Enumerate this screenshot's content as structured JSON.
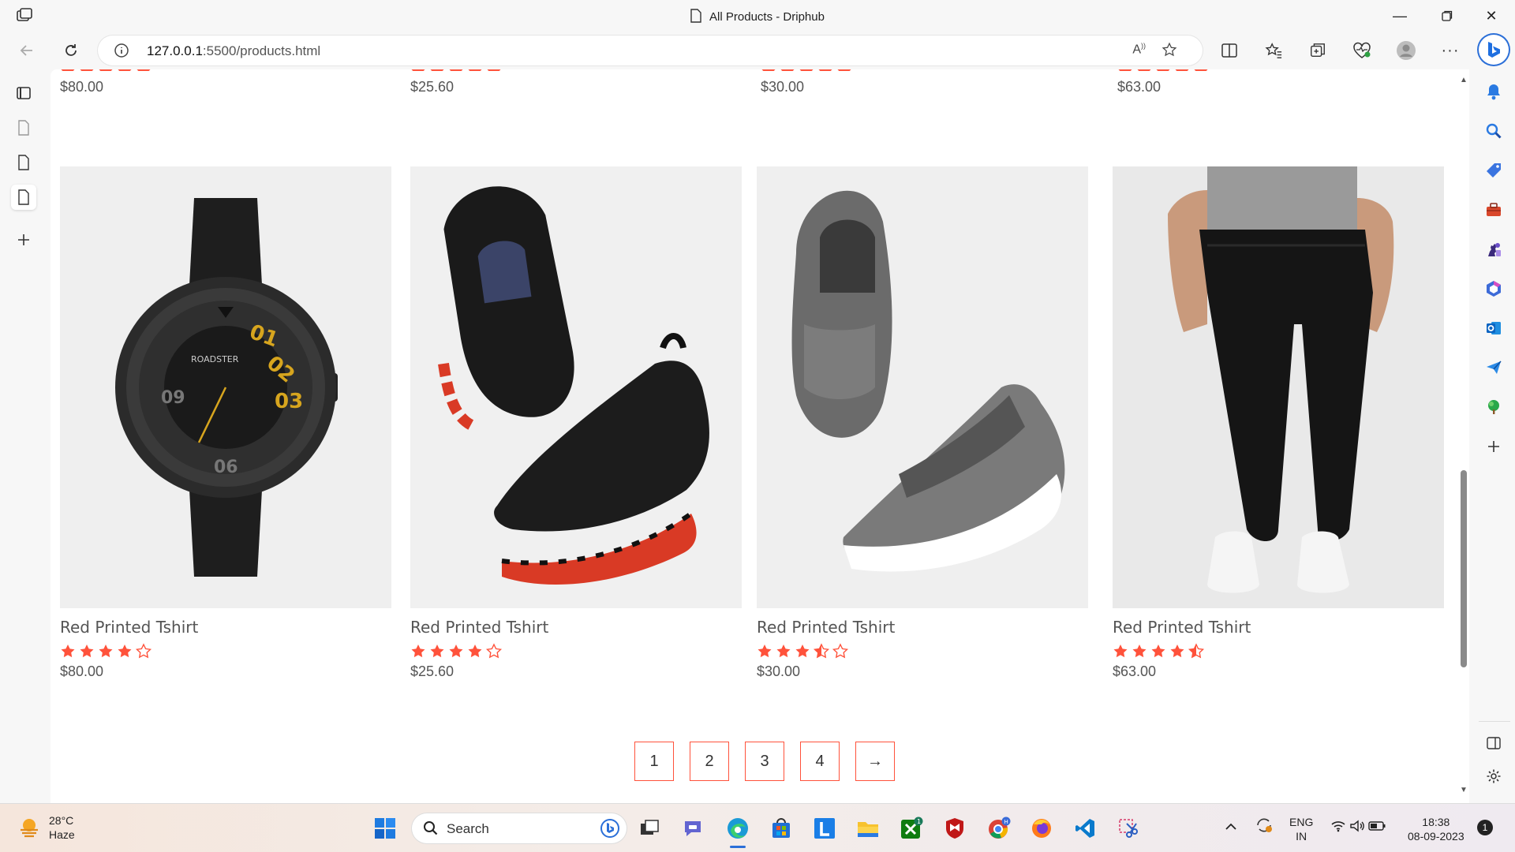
{
  "browser": {
    "tab_title": "All Products - Driphub",
    "url_host": "127.0.0.1",
    "url_path": ":5500/products.html"
  },
  "top_row_prices": [
    "$80.00",
    "$25.60",
    "$30.00",
    "$63.00"
  ],
  "products": [
    {
      "name": "Red Printed Tshirt",
      "rating": 4,
      "price": "$80.00",
      "image": "watch"
    },
    {
      "name": "Red Printed Tshirt",
      "rating": 4,
      "price": "$25.60",
      "image": "black-sneakers"
    },
    {
      "name": "Red Printed Tshirt",
      "rating": 3.5,
      "price": "$30.00",
      "image": "grey-slip-ons"
    },
    {
      "name": "Red Printed Tshirt",
      "rating": 4.5,
      "price": "$63.00",
      "image": "joggers"
    }
  ],
  "pagination": [
    "1",
    "2",
    "3",
    "4",
    "→"
  ],
  "colors": {
    "accent": "#ff523b"
  },
  "taskbar": {
    "weather_temp": "28°C",
    "weather_desc": "Haze",
    "search_label": "Search",
    "lang_1": "ENG",
    "lang_2": "IN",
    "time": "18:38",
    "date": "08-09-2023",
    "notif_count": "1"
  }
}
